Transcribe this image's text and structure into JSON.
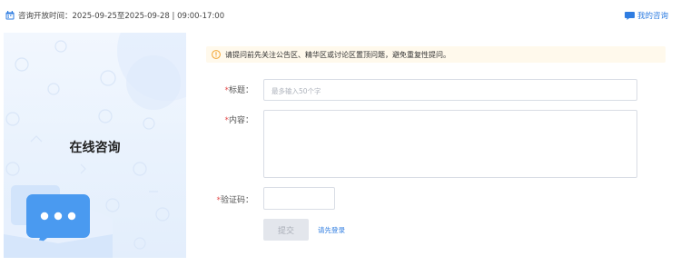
{
  "header": {
    "open_time_text": "咨询开放时间：2025-09-25至2025-09-28 | 09:00-17:00",
    "my_consult_label": "我的咨询",
    "calendar_icon": "calendar-icon",
    "chat_icon": "chat-icon"
  },
  "left_panel": {
    "title": "在线咨询"
  },
  "notice": {
    "icon": "warning-icon",
    "text": "请提问前先关注公告区、精华区或讨论区置顶问题，避免重复性提问。"
  },
  "form": {
    "title_label": "标题：",
    "title_placeholder": "最多输入50个字",
    "title_value": "",
    "content_label": "内容：",
    "content_value": "",
    "captcha_label": "验证码：",
    "captcha_value": "",
    "required_mark": "*",
    "submit_label": "提交",
    "login_link": "请先登录"
  },
  "colors": {
    "accent": "#2f7de1",
    "required": "#e34d4d",
    "notice_bg": "#fff9ec",
    "warning": "#f3a532"
  }
}
